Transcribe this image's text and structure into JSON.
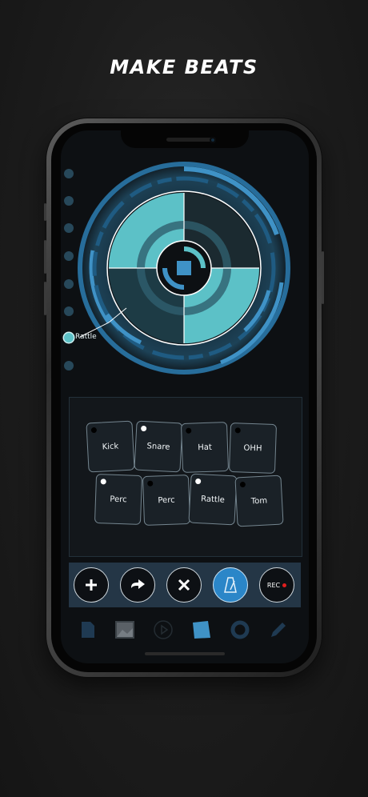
{
  "headline": "MAKE BEATS",
  "tracks": [
    {
      "label": "",
      "active": false
    },
    {
      "label": "",
      "active": false
    },
    {
      "label": "",
      "active": false
    },
    {
      "label": "",
      "active": false
    },
    {
      "label": "",
      "active": false
    },
    {
      "label": "",
      "active": false
    },
    {
      "label": "Rattle",
      "active": true
    },
    {
      "label": "",
      "active": false
    }
  ],
  "pads": [
    {
      "label": "Kick",
      "led": false
    },
    {
      "label": "Snare",
      "led": true
    },
    {
      "label": "Hat",
      "led": false
    },
    {
      "label": "OHH",
      "led": false
    },
    {
      "label": "Perc",
      "led": true
    },
    {
      "label": "Perc",
      "led": false
    },
    {
      "label": "Rattle",
      "led": true
    },
    {
      "label": "Tom",
      "led": false
    }
  ],
  "controls": {
    "add_icon": "plus-icon",
    "redo_icon": "arrow-right-icon",
    "clear_icon": "x-icon",
    "metronome_icon": "metronome-icon",
    "rec_label": "REC"
  },
  "tabs": [
    "document-icon",
    "image-icon",
    "play-icon",
    "pad-icon",
    "circle-icon",
    "pencil-icon"
  ],
  "colors": {
    "accent": "#2b86c8",
    "teal": "#5cc1c7",
    "dark_teal": "#1d3b45",
    "record": "#e01e1e"
  }
}
